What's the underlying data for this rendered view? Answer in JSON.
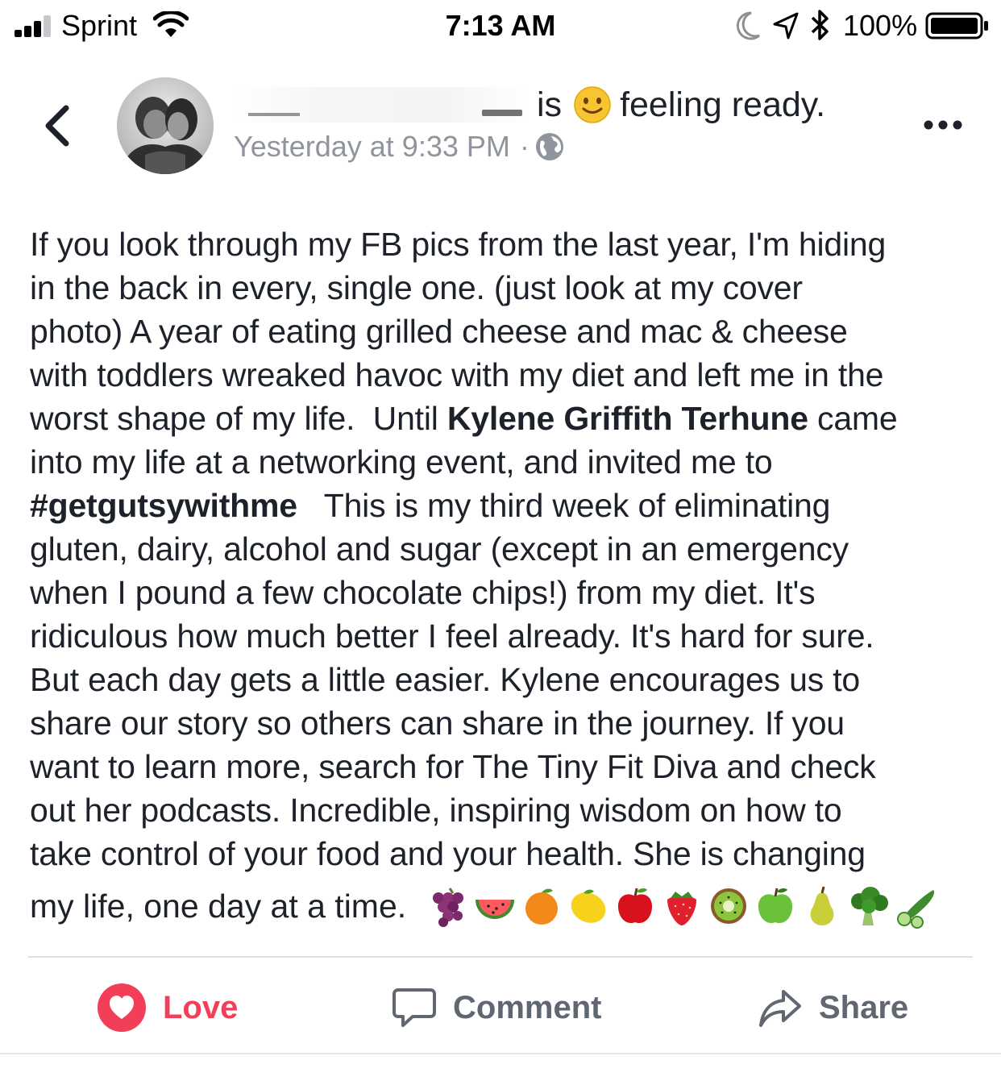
{
  "status_bar": {
    "carrier": "Sprint",
    "time": "7:13 AM",
    "battery": "100%"
  },
  "post": {
    "feeling_prefix": "is",
    "feeling": "feeling ready.",
    "timestamp": "Yesterday at 9:33 PM",
    "separator": "·",
    "lines": [
      "If you look through my FB pics from the last year, I'm hiding",
      "in the back in every, single one.  (just look at my cover",
      "photo)  A year of eating grilled cheese and mac & cheese",
      "with toddlers wreaked havoc with my diet and left me in the"
    ],
    "line5_pre": "worst shape of my life.  Until ",
    "mention": "Kylene Griffith Terhune",
    "line5_post": " came",
    "line6": "into my life at a networking event, and invited me to",
    "hashtag": "#getgutsywithme",
    "line7_post": "   This is my third week of eliminating",
    "lines_after": [
      "gluten, dairy, alcohol and sugar (except in an emergency",
      "when I pound a few chocolate chips!) from my diet.  It's",
      "ridiculous how much better I feel already.  It's hard for sure.",
      "But each day gets a little easier.  Kylene encourages us to",
      "share our story so others can share in the journey.  If you",
      "want to learn more, search for The Tiny Fit Diva and check",
      "out her podcasts.  Incredible, inspiring wisdom on how to",
      "take control of your food and your health.  She is changing"
    ],
    "last_line": "my life, one day at a time.",
    "emojis": [
      "grapes-icon",
      "watermelon-icon",
      "orange-icon",
      "lemon-icon",
      "apple-icon",
      "strawberry-icon",
      "kiwi-icon",
      "green-apple-icon",
      "pear-icon",
      "broccoli-icon",
      "cucumber-icon"
    ]
  },
  "actions": {
    "love": "Love",
    "comment": "Comment",
    "share": "Share"
  },
  "colors": {
    "love": "#f33e58",
    "muted": "#606770",
    "timestamp": "#90949c",
    "text": "#1d2129"
  }
}
